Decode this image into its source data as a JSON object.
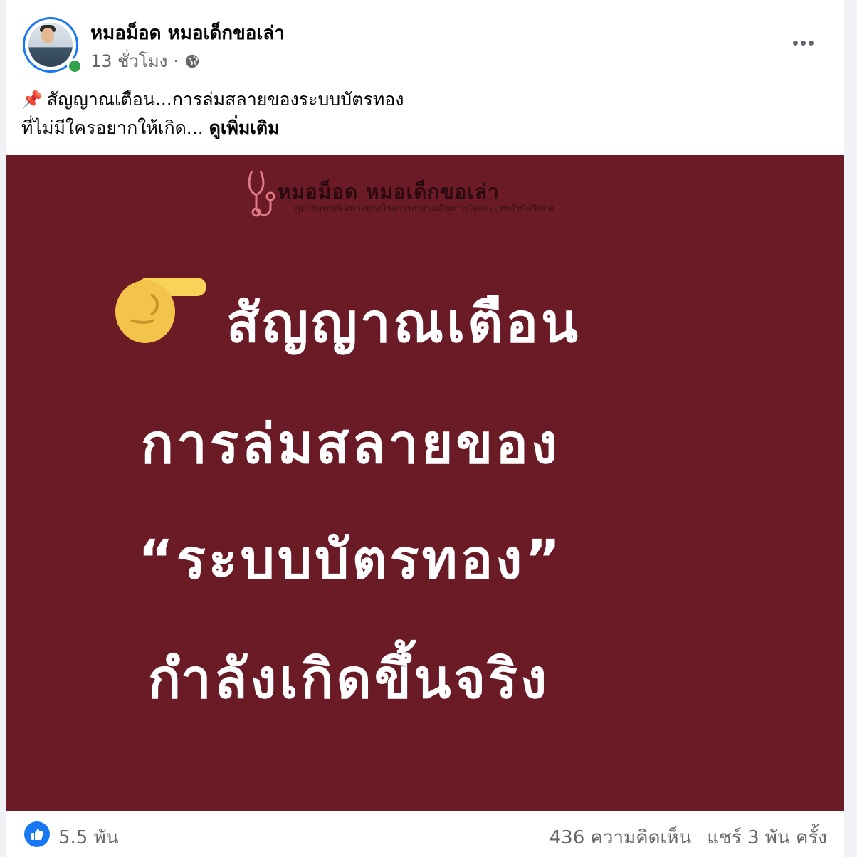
{
  "post": {
    "author": "หมอม็อด หมอเด็กขอเล่า",
    "time": "13 ชั่วโมง",
    "separator": "·",
    "caption_line1": "สัญญาณเตือน...การล่มสลายของระบบบัตรทอง",
    "caption_line2": "ที่ไม่มีใครอยากให้เกิด...",
    "see_more": "ดูเพิ่มเติม",
    "caption_icon": "pushpin-icon"
  },
  "image": {
    "logo_title": "หมอม็อด หมอเด็กขอเล่า",
    "logo_subtitle": "กุมารแพทย์เฉพาะทางโรคระบบทางเดินหายใจและเวชบำบัดวิกฤต",
    "line1": "สัญญาณเตือน",
    "line2": "การล่มสลายของ",
    "line3": "“ระบบบัตรทอง”",
    "line4": "กำลังเกิดขึ้นจริง",
    "background_color": "#6a1b26",
    "pointer_icon": "pointing-right-hand-icon"
  },
  "footer": {
    "reactions": "5.5 พัน",
    "comments": "436 ความคิดเห็น",
    "shares": "แชร์ 3 พัน ครั้ง"
  },
  "colors": {
    "accent": "#1877f2",
    "online": "#31a24c",
    "secondary_text": "#65676b"
  }
}
